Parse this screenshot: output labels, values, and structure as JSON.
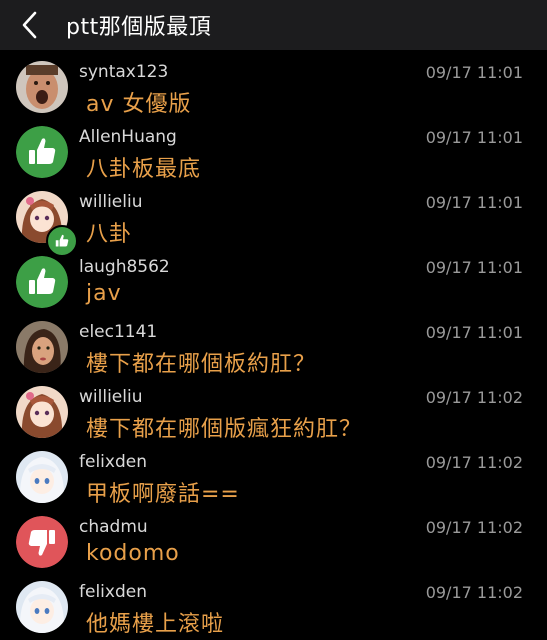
{
  "header": {
    "title": "ptt那個版最頂"
  },
  "comments": [
    {
      "user": "syntax123",
      "time": "09/17 11:01",
      "text": "av 女優版",
      "avatar": "photo-man-icon"
    },
    {
      "user": "AllenHuang",
      "time": "09/17 11:01",
      "text": "八卦板最底",
      "avatar": "thumbs-up-icon"
    },
    {
      "user": "willieliu",
      "time": "09/17 11:01",
      "text": "八卦",
      "avatar": "anime-girl-icon"
    },
    {
      "user": "laugh8562",
      "time": "09/17 11:01",
      "text": "jav",
      "avatar": "thumbs-up-icon"
    },
    {
      "user": "elec1141",
      "time": "09/17 11:01",
      "text": "樓下都在哪個板約肛？",
      "avatar": "photo-woman-icon"
    },
    {
      "user": "willieliu",
      "time": "09/17 11:02",
      "text": "樓下都在哪個版瘋狂約肛？",
      "avatar": "anime-girl-icon"
    },
    {
      "user": "felixden",
      "time": "09/17 11:02",
      "text": "甲板啊廢話==",
      "avatar": "anime-white-hair-icon"
    },
    {
      "user": "chadmu",
      "time": "09/17 11:02",
      "text": "kodomo",
      "avatar": "thumbs-down-icon"
    },
    {
      "user": "felixden",
      "time": "09/17 11:02",
      "text": "他媽樓上滾啦",
      "avatar": "anime-white-hair-icon"
    }
  ],
  "colors": {
    "like": "#3d9f46",
    "dislike": "#e0555a",
    "message": "#e8a04a"
  }
}
